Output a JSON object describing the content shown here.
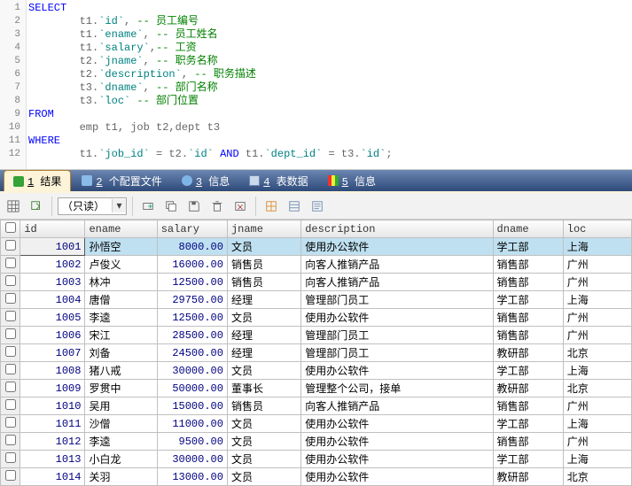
{
  "editor": {
    "lines": [
      {
        "n": 1,
        "segments": [
          {
            "t": "SELECT",
            "c": "kw"
          }
        ]
      },
      {
        "n": 2,
        "segments": [
          {
            "t": "        t1.",
            "c": "norm"
          },
          {
            "t": "`id`",
            "c": "ident"
          },
          {
            "t": ",",
            "c": "norm"
          },
          {
            "t": " -- 员工编号",
            "c": "comment"
          }
        ]
      },
      {
        "n": 3,
        "segments": [
          {
            "t": "        t1.",
            "c": "norm"
          },
          {
            "t": "`ename`",
            "c": "ident"
          },
          {
            "t": ",",
            "c": "norm"
          },
          {
            "t": " -- 员工姓名",
            "c": "comment"
          }
        ]
      },
      {
        "n": 4,
        "segments": [
          {
            "t": "        t1.",
            "c": "norm"
          },
          {
            "t": "`salary`",
            "c": "ident"
          },
          {
            "t": ",",
            "c": "norm"
          },
          {
            "t": "-- 工资",
            "c": "comment"
          }
        ]
      },
      {
        "n": 5,
        "segments": [
          {
            "t": "        t2.",
            "c": "norm"
          },
          {
            "t": "`jname`",
            "c": "ident"
          },
          {
            "t": ",",
            "c": "norm"
          },
          {
            "t": " -- 职务名称",
            "c": "comment"
          }
        ]
      },
      {
        "n": 6,
        "segments": [
          {
            "t": "        t2.",
            "c": "norm"
          },
          {
            "t": "`description`",
            "c": "ident"
          },
          {
            "t": ",",
            "c": "norm"
          },
          {
            "t": " -- 职务描述",
            "c": "comment"
          }
        ]
      },
      {
        "n": 7,
        "segments": [
          {
            "t": "        t3.",
            "c": "norm"
          },
          {
            "t": "`dname`",
            "c": "ident"
          },
          {
            "t": ",",
            "c": "norm"
          },
          {
            "t": " -- 部门名称",
            "c": "comment"
          }
        ]
      },
      {
        "n": 8,
        "segments": [
          {
            "t": "        t3.",
            "c": "norm"
          },
          {
            "t": "`loc`",
            "c": "ident"
          },
          {
            "t": " -- 部门位置",
            "c": "comment"
          }
        ]
      },
      {
        "n": 9,
        "segments": [
          {
            "t": "FROM",
            "c": "kw"
          }
        ]
      },
      {
        "n": 10,
        "segments": [
          {
            "t": "        emp t1, job t2,dept t3",
            "c": "norm"
          }
        ]
      },
      {
        "n": 11,
        "segments": [
          {
            "t": "WHERE",
            "c": "kw"
          }
        ]
      },
      {
        "n": 12,
        "segments": [
          {
            "t": "        t1.",
            "c": "norm"
          },
          {
            "t": "`job_id`",
            "c": "ident"
          },
          {
            "t": " = t2.",
            "c": "norm"
          },
          {
            "t": "`id`",
            "c": "ident"
          },
          {
            "t": " ",
            "c": "norm"
          },
          {
            "t": "AND",
            "c": "kw"
          },
          {
            "t": " t1.",
            "c": "norm"
          },
          {
            "t": "`dept_id`",
            "c": "ident"
          },
          {
            "t": " = t3.",
            "c": "norm"
          },
          {
            "t": "`id`",
            "c": "ident"
          },
          {
            "t": ";",
            "c": "norm"
          }
        ]
      }
    ]
  },
  "tabs": [
    {
      "key": "t1",
      "prefix": "1",
      "label": " 结果",
      "active": true,
      "iconClass": "ic-green"
    },
    {
      "key": "t2",
      "prefix": "2",
      "label": " 个配置文件",
      "iconClass": "ic-cfg"
    },
    {
      "key": "t3",
      "prefix": "3",
      "label": " 信息",
      "iconClass": "ic-info"
    },
    {
      "key": "t4",
      "prefix": "4",
      "label": " 表数据",
      "iconClass": "ic-grid"
    },
    {
      "key": "t5",
      "prefix": "5",
      "label": " 信息",
      "iconClass": "ic-stats"
    }
  ],
  "toolbar": {
    "mode_value": "（只读）"
  },
  "grid": {
    "columns": [
      "id",
      "ename",
      "salary",
      "jname",
      "description",
      "dname",
      "loc"
    ],
    "rows": [
      {
        "id": "1001",
        "ename": "孙悟空",
        "salary": "8000.00",
        "jname": "文员",
        "description": "使用办公软件",
        "dname": "学工部",
        "loc": "上海",
        "sel": true
      },
      {
        "id": "1002",
        "ename": "卢俊义",
        "salary": "16000.00",
        "jname": "销售员",
        "description": "向客人推销产品",
        "dname": "销售部",
        "loc": "广州"
      },
      {
        "id": "1003",
        "ename": "林冲",
        "salary": "12500.00",
        "jname": "销售员",
        "description": "向客人推销产品",
        "dname": "销售部",
        "loc": "广州"
      },
      {
        "id": "1004",
        "ename": "唐僧",
        "salary": "29750.00",
        "jname": "经理",
        "description": "管理部门员工",
        "dname": "学工部",
        "loc": "上海"
      },
      {
        "id": "1005",
        "ename": "李逵",
        "salary": "12500.00",
        "jname": "文员",
        "description": "使用办公软件",
        "dname": "销售部",
        "loc": "广州"
      },
      {
        "id": "1006",
        "ename": "宋江",
        "salary": "28500.00",
        "jname": "经理",
        "description": "管理部门员工",
        "dname": "销售部",
        "loc": "广州"
      },
      {
        "id": "1007",
        "ename": "刘备",
        "salary": "24500.00",
        "jname": "经理",
        "description": "管理部门员工",
        "dname": "教研部",
        "loc": "北京"
      },
      {
        "id": "1008",
        "ename": "猪八戒",
        "salary": "30000.00",
        "jname": "文员",
        "description": "使用办公软件",
        "dname": "学工部",
        "loc": "上海"
      },
      {
        "id": "1009",
        "ename": "罗贯中",
        "salary": "50000.00",
        "jname": "董事长",
        "description": "管理整个公司，接单",
        "dname": "教研部",
        "loc": "北京"
      },
      {
        "id": "1010",
        "ename": "吴用",
        "salary": "15000.00",
        "jname": "销售员",
        "description": "向客人推销产品",
        "dname": "销售部",
        "loc": "广州"
      },
      {
        "id": "1011",
        "ename": "沙僧",
        "salary": "11000.00",
        "jname": "文员",
        "description": "使用办公软件",
        "dname": "学工部",
        "loc": "上海"
      },
      {
        "id": "1012",
        "ename": "李逵",
        "salary": "9500.00",
        "jname": "文员",
        "description": "使用办公软件",
        "dname": "销售部",
        "loc": "广州"
      },
      {
        "id": "1013",
        "ename": "小白龙",
        "salary": "30000.00",
        "jname": "文员",
        "description": "使用办公软件",
        "dname": "学工部",
        "loc": "上海"
      },
      {
        "id": "1014",
        "ename": "关羽",
        "salary": "13000.00",
        "jname": "文员",
        "description": "使用办公软件",
        "dname": "教研部",
        "loc": "北京"
      }
    ]
  }
}
